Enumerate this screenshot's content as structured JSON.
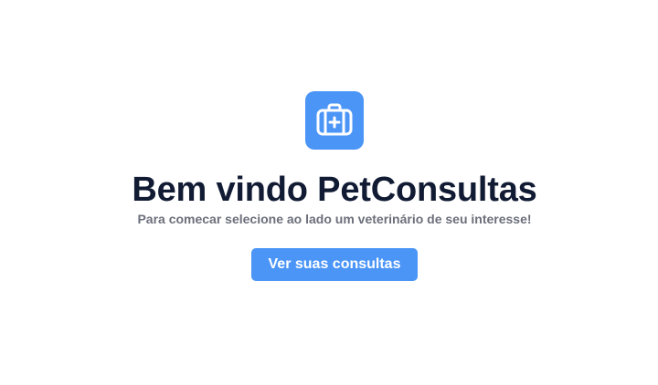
{
  "hero": {
    "icon": "medical-kit-icon",
    "title": "Bem vindo PetConsultas",
    "subtitle": "Para comecar selecione ao lado um veterinário de seu interesse!",
    "button_label": "Ver suas consultas"
  },
  "colors": {
    "accent": "#4b95f7",
    "title": "#111b33",
    "subtitle": "#6b6f7a",
    "background": "#ffffff"
  }
}
